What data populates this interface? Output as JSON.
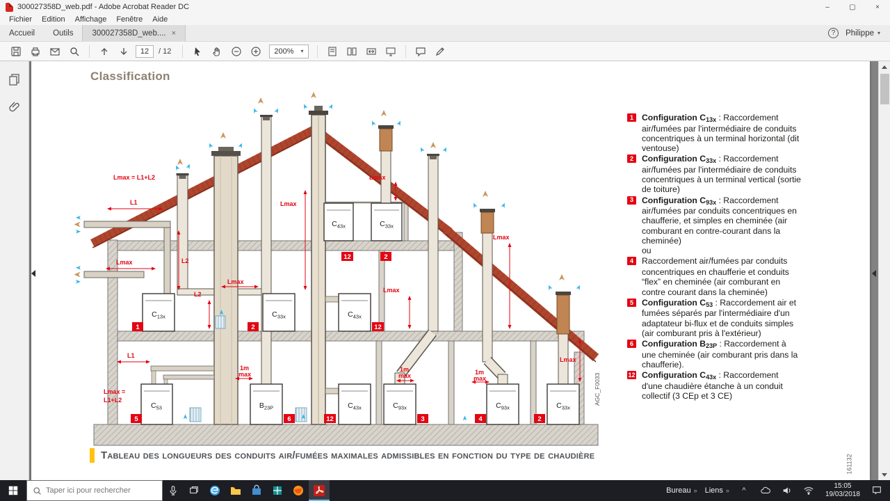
{
  "window": {
    "title": "300027358D_web.pdf - Adobe Acrobat Reader DC",
    "minimize": "–",
    "maximize": "▢",
    "close": "×"
  },
  "menu": {
    "items": [
      "Fichier",
      "Edition",
      "Affichage",
      "Fenêtre",
      "Aide"
    ]
  },
  "tabs": {
    "home": "Accueil",
    "tools": "Outils",
    "doc": "300027358D_web....",
    "close": "×",
    "help": "?",
    "user": "Philippe",
    "caret": "▾"
  },
  "toolbar": {
    "page": "12",
    "page_total": "/ 12",
    "zoom": "200%",
    "zoom_caret": "▾",
    "icons": [
      "save",
      "print",
      "email",
      "search",
      "previous-page",
      "next-page",
      "select",
      "hand",
      "zoom-out",
      "zoom-in",
      "page-view",
      "two-page-view",
      "fit-width",
      "reading-mode",
      "comment",
      "highlight"
    ]
  },
  "sidebar": {
    "icons": [
      "page-thumbnails",
      "attachments"
    ]
  },
  "page": {
    "heading": "Classification",
    "footer": "Tableau des longueurs des conduits air/fumées maximales admissibles en fonction du type de chaudière",
    "code_vertical": "161132"
  },
  "diagram": {
    "side_code": "AGC_F0033",
    "dims": [
      "Lmax = L1+L2",
      "L1",
      "L2",
      "Lmax",
      "L2",
      "Lmax",
      "Lmax",
      "Lmax",
      "Lmax",
      "Lmax",
      "Lmax",
      "L1",
      "Lmax =",
      "L1+L2",
      "1m",
      "max",
      "1m",
      "max",
      "1m",
      "max"
    ],
    "boilers": [
      {
        "main": "C",
        "sub": "13x"
      },
      {
        "main": "C",
        "sub": "33x"
      },
      {
        "main": "C",
        "sub": "43x"
      },
      {
        "main": "C",
        "sub": "43x"
      },
      {
        "main": "C",
        "sub": "33x"
      },
      {
        "main": "C",
        "sub": "53"
      },
      {
        "main": "B",
        "sub": "23P"
      },
      {
        "main": "C",
        "sub": "43x"
      },
      {
        "main": "C",
        "sub": "93x"
      },
      {
        "main": "C",
        "sub": "93x"
      },
      {
        "main": "C",
        "sub": "33x"
      }
    ],
    "badges": [
      "1",
      "2",
      "12",
      "12",
      "2",
      "5",
      "6",
      "12",
      "3",
      "4",
      "2"
    ]
  },
  "legend": {
    "items": [
      {
        "num": "1",
        "bold": "Configuration C",
        "sub": "13x",
        "text": " : Raccordement air/fumées par l'intermédiaire de conduits concentriques à un terminal horizontal (dit ventouse)",
        "extra": ""
      },
      {
        "num": "2",
        "bold": "Configuration C",
        "sub": "33x",
        "text": " : Raccordement air/fumées par l'intermédiaire de conduits concentriques à un terminal vertical (sortie de toiture)",
        "extra": ""
      },
      {
        "num": "3",
        "bold": "Configuration C",
        "sub": "93x",
        "text": " : Raccordement air/fumées par conduits concentriques en chaufferie, et simples en cheminée (air comburant en contre-courant dans la cheminée)",
        "extra": "ou"
      },
      {
        "num": "4",
        "bold": "",
        "sub": "",
        "text": "Raccordement air/fumées par conduits concentriques en chaufferie et conduits “flex” en cheminée (air comburant en contre courant dans la cheminée)",
        "extra": ""
      },
      {
        "num": "5",
        "bold": "Configuration C",
        "sub": "53",
        "text": " : Raccordement air et fumées séparés par l'intermédiaire d'un adaptateur bi-flux et de conduits simples (air comburant pris à l'extérieur)",
        "extra": ""
      },
      {
        "num": "6",
        "bold": "Configuration B",
        "sub": "23P",
        "text": " : Raccordement à une cheminée (air comburant pris dans la chaufferie).",
        "extra": ""
      },
      {
        "num": "12",
        "bold": "Configuration C",
        "sub": "43x",
        "text": " : Raccordement d'une chaudière étanche à un conduit collectif (3 CEp et 3 CE)",
        "extra": ""
      }
    ]
  },
  "taskbar": {
    "search_placeholder": "Taper ici pour rechercher",
    "tray_left": "Bureau",
    "tray_right": "Liens",
    "chevrons": "»",
    "expand": "^",
    "time": "15:05",
    "date": "19/03/2018",
    "icons": [
      "start",
      "search",
      "microphone",
      "task-view",
      "edge",
      "file-explorer",
      "store",
      "office",
      "firefox",
      "acrobat"
    ],
    "tray_icons": [
      "cloud",
      "volume",
      "network",
      "notifications"
    ]
  }
}
